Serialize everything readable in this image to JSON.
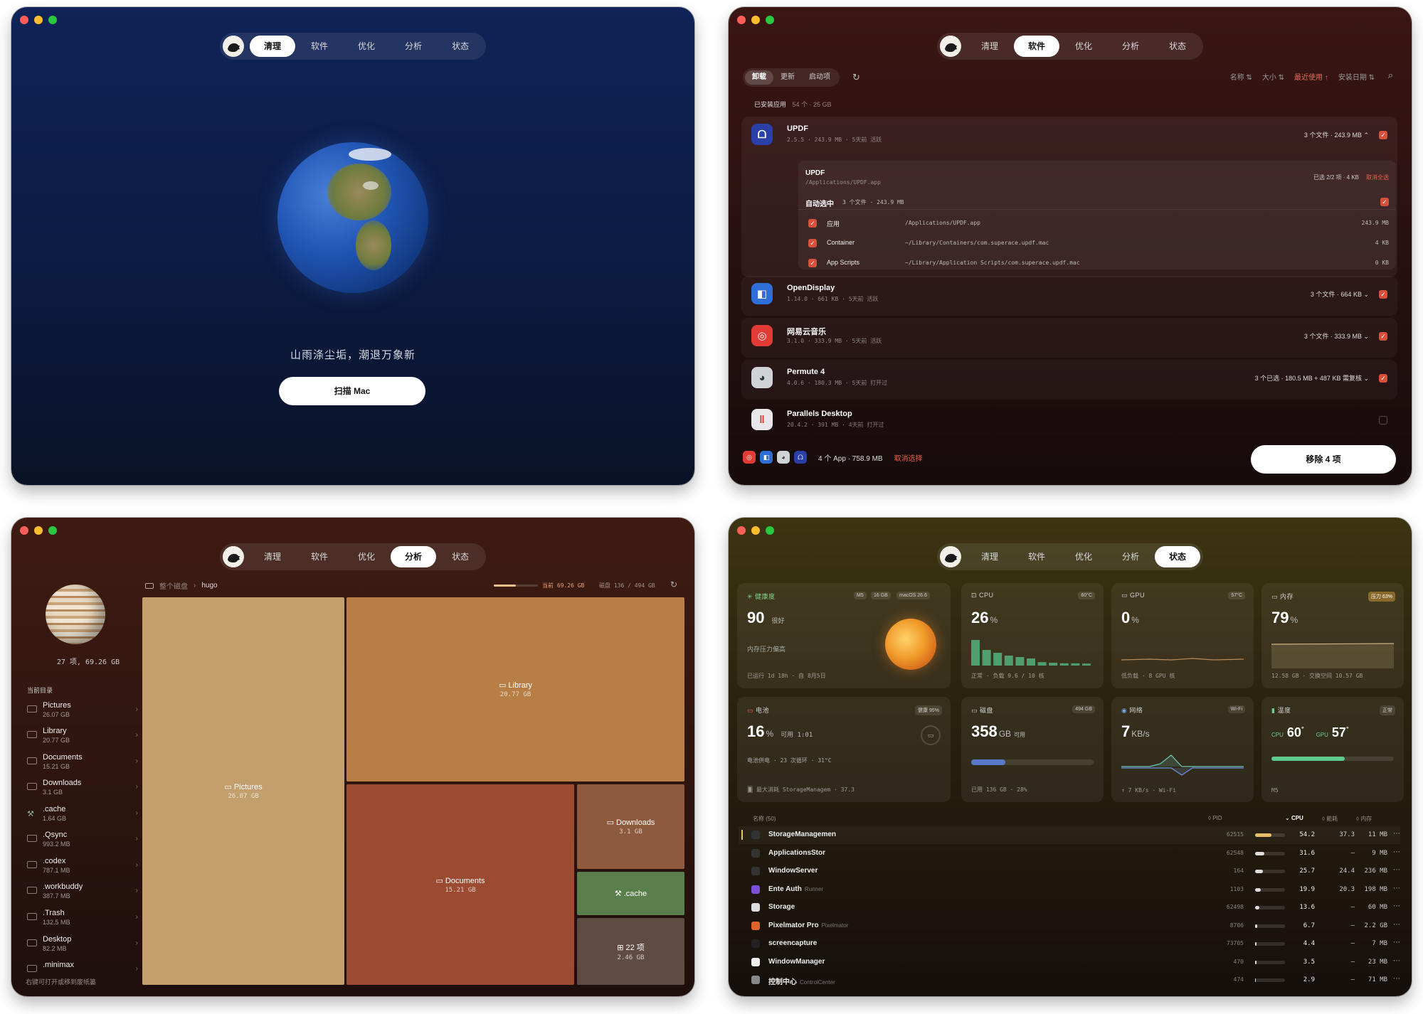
{
  "nav": {
    "tabs": [
      "清理",
      "软件",
      "优化",
      "分析",
      "状态"
    ]
  },
  "w1": {
    "slogan": "山雨涤尘垢，潮退万象新",
    "scan_label": "扫描 Mac"
  },
  "w2": {
    "subtabs": [
      "卸载",
      "更新",
      "启动项"
    ],
    "refresh_icon": "↻",
    "sorts": [
      "名称 ⇅",
      "大小 ⇅",
      "最近使用 ↑",
      "安装日期 ⇅"
    ],
    "section_title": "已安装应用",
    "section_count": "54 个 · 25 GB",
    "apps": [
      {
        "name": "UPDF",
        "sub": "2.5.5 · 243.9 MB · 5天前 活跃",
        "right": "3 个文件 · 243.9 MB ⌃",
        "color": "#2a3fa8",
        "glyph": "ᗝ"
      },
      {
        "name": "OpenDisplay",
        "sub": "1.14.0 · 661 KB · 5天前 活跃",
        "right": "3 个文件 · 664 KB ⌄",
        "color": "#2d6fd6",
        "glyph": "◧"
      },
      {
        "name": "网易云音乐",
        "sub": "3.1.0 · 333.9 MB · 5天前 活跃",
        "right": "3 个文件 · 333.9 MB ⌄",
        "color": "#e23b36",
        "glyph": "◎"
      },
      {
        "name": "Permute 4",
        "sub": "4.0.6 · 180.3 MB · 5天前 打开过",
        "right": "3 个已选 · 180.5 MB + 487 KB 需复核 ⌄",
        "color": "#cfd3d6",
        "glyph": "◕"
      },
      {
        "name": "Parallels Desktop",
        "sub": "20.4.2 · 391 MB · 4天前 打开过",
        "right": "",
        "color": "#e8e8ea",
        "glyph": "‖"
      }
    ],
    "detail": {
      "name": "UPDF",
      "path": "/Applications/UPDF.app",
      "summary": "已选 2/2 项 · 4 KB",
      "cancel_all": "取消全选",
      "auto_label": "自动选中",
      "auto_info": "3 个文件 · 243.9 MB",
      "rows": [
        {
          "label": "应用",
          "path": "/Applications/UPDF.app",
          "size": "243.9 MB"
        },
        {
          "label": "Container",
          "path": "~/Library/Containers/com.superace.updf.mac",
          "size": "4 KB"
        },
        {
          "label": "App Scripts",
          "path": "~/Library/Application Scripts/com.superace.updf.mac",
          "size": "0 KB"
        }
      ]
    },
    "footer": {
      "summary": "4 个 App · 758.9 MB",
      "cancel": "取消选择",
      "remove": "移除 4 项"
    }
  },
  "w3": {
    "stats": "27 项, 69.26 GB",
    "section": "当前目录",
    "crumb_root": "整个磁盘",
    "crumb_leaf": "hugo",
    "current": "当前 69.26 GB",
    "disk": "磁盘 136 / 494 GB",
    "items": [
      {
        "name": "Pictures",
        "size": "26.07 GB"
      },
      {
        "name": "Library",
        "size": "20.77 GB"
      },
      {
        "name": "Documents",
        "size": "15.21 GB"
      },
      {
        "name": "Downloads",
        "size": "3.1 GB"
      },
      {
        "name": ".cache",
        "size": "1.64 GB"
      },
      {
        "name": ".Qsync",
        "size": "993.2 MB"
      },
      {
        "name": ".codex",
        "size": "787.1 MB"
      },
      {
        "name": ".workbuddy",
        "size": "387.7 MB"
      },
      {
        "name": ".Trash",
        "size": "132.5 MB"
      },
      {
        "name": "Desktop",
        "size": "82.2 MB"
      },
      {
        "name": ".minimax",
        "size": ""
      }
    ],
    "hint": "右键可打开或移到废纸篓",
    "tiles": {
      "pictures": {
        "name": "Pictures",
        "size": "26.07 GB"
      },
      "library": {
        "name": "Library",
        "size": "20.77 GB"
      },
      "documents": {
        "name": "Documents",
        "size": "15.21 GB"
      },
      "downloads": {
        "name": "Downloads",
        "size": "3.1 GB"
      },
      "cache": {
        "name": ".cache"
      },
      "more": {
        "name": "22 项",
        "size": "2.46 GB"
      }
    }
  },
  "w4": {
    "health": {
      "title": "健康度",
      "badges": [
        "M5",
        "16 GB",
        "macOS 26.6"
      ],
      "value": "90",
      "word": "很好",
      "note": "内存压力偏高",
      "footer": "已运行 1d 18h · 自 8月5日"
    },
    "cpu": {
      "title": "CPU",
      "temp": "60°C",
      "value": "26",
      "unit": "%",
      "footer": "正常 · 负载 9.6 / 10 核",
      "bars": [
        0.9,
        0.55,
        0.45,
        0.35,
        0.3,
        0.25,
        0.12,
        0.1,
        0.08,
        0.08,
        0.07
      ]
    },
    "gpu": {
      "title": "GPU",
      "temp": "57°C",
      "value": "0",
      "unit": "%",
      "footer": "低负载 · 8 GPU 核"
    },
    "mem": {
      "title": "内存",
      "badge": "压力 63%",
      "value": "79",
      "unit": "%",
      "footer": "12.58 GB · 交换空间 10.57 GB"
    },
    "battery": {
      "title": "电池",
      "badge": "健康 95%",
      "value": "16",
      "unit": "%",
      "avail": "可用 1:01",
      "line": "电池供电 · 23 次循环 · 31°C",
      "footer": "最大消耗 StorageManagem · 37.3"
    },
    "disk": {
      "title": "磁盘",
      "badge": "494 GB",
      "value": "358",
      "unit": "GB",
      "avail": "可用",
      "footer": "已用 136 GB · 28%",
      "fill": 0.28
    },
    "net": {
      "title": "网络",
      "badge": "Wi-Fi",
      "value": "7",
      "unit": "KB/s",
      "footer": "↑ 7 KB/s · Wi-Fi"
    },
    "temp": {
      "title": "温度",
      "badge": "正常",
      "cpu_label": "CPU",
      "cpu": "60",
      "gpu_label": "GPU",
      "gpu": "57",
      "footer": "M5",
      "fill": 0.6
    },
    "table": {
      "headers": [
        "名称 (50)",
        "PID",
        "CPU",
        "能耗",
        "内存"
      ],
      "rows": [
        {
          "name": "StorageManagemen",
          "sub": "",
          "pid": "62515",
          "cpu": "54.2",
          "cpuv": 0.54,
          "energy": "37.3",
          "mem": "11 MB",
          "icon": "#333"
        },
        {
          "name": "ApplicationsStor",
          "sub": "",
          "pid": "62548",
          "cpu": "31.6",
          "cpuv": 0.32,
          "energy": "—",
          "mem": "9 MB",
          "icon": "#333"
        },
        {
          "name": "WindowServer",
          "sub": "",
          "pid": "164",
          "cpu": "25.7",
          "cpuv": 0.26,
          "energy": "24.4",
          "mem": "236 MB",
          "icon": "#333"
        },
        {
          "name": "Ente Auth",
          "sub": "Runner",
          "pid": "1103",
          "cpu": "19.9",
          "cpuv": 0.2,
          "energy": "20.3",
          "mem": "198 MB",
          "icon": "#7b4fd6"
        },
        {
          "name": "Storage",
          "sub": "",
          "pid": "62498",
          "cpu": "13.6",
          "cpuv": 0.14,
          "energy": "—",
          "mem": "60 MB",
          "icon": "#ddd"
        },
        {
          "name": "Pixelmator Pro",
          "sub": "Pixelmator",
          "pid": "8706",
          "cpu": "6.7",
          "cpuv": 0.07,
          "energy": "—",
          "mem": "2.2 GB",
          "icon": "#e0642c"
        },
        {
          "name": "screencapture",
          "sub": "",
          "pid": "73705",
          "cpu": "4.4",
          "cpuv": 0.05,
          "energy": "—",
          "mem": "7 MB",
          "icon": "#222"
        },
        {
          "name": "WindowManager",
          "sub": "",
          "pid": "470",
          "cpu": "3.5",
          "cpuv": 0.04,
          "energy": "—",
          "mem": "23 MB",
          "icon": "#eee"
        },
        {
          "name": "控制中心",
          "sub": "ControlCenter",
          "pid": "474",
          "cpu": "2.9",
          "cpuv": 0.03,
          "energy": "—",
          "mem": "71 MB",
          "icon": "#888"
        }
      ]
    }
  }
}
